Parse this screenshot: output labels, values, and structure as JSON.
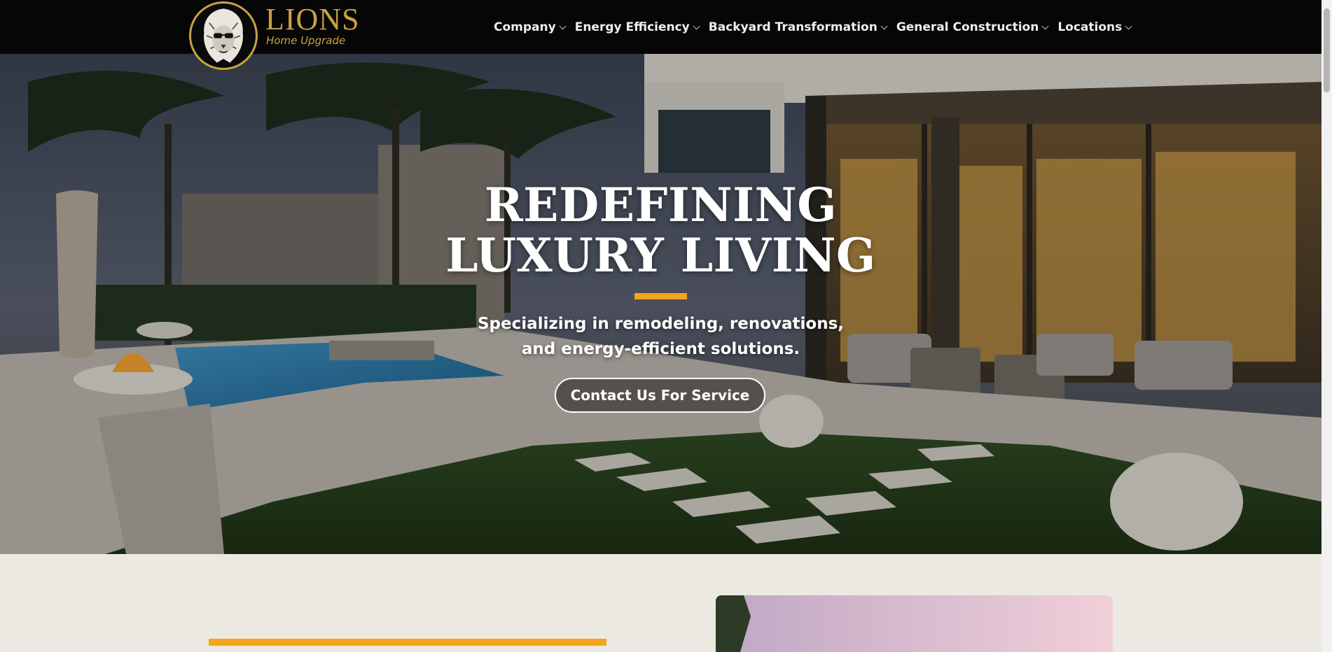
{
  "brand": {
    "title": "LIONS",
    "subtitle": "Home Upgrade",
    "logo_icon": "lion-head-icon",
    "gold": "#c9a341"
  },
  "nav": {
    "items": [
      {
        "label": "Company",
        "icon": "chevron-down-icon"
      },
      {
        "label": "Energy Efficiency",
        "icon": "chevron-down-icon"
      },
      {
        "label": "Backyard Transformation",
        "icon": "chevron-down-icon"
      },
      {
        "label": "General Construction",
        "icon": "chevron-down-icon"
      },
      {
        "label": "Locations",
        "icon": "chevron-down-icon"
      }
    ]
  },
  "hero": {
    "title_line1": "REDEFINING",
    "title_line2": "LUXURY LIVING",
    "subtitle_line1": "Specializing in remodeling, renovations,",
    "subtitle_line2": "and energy-efficient solutions.",
    "cta_label": "Contact Us For Service",
    "accent_color": "#f5a51c"
  },
  "colors": {
    "header_bg": "#060606",
    "page_bg": "#ece9e2",
    "accent": "#f5a51c"
  }
}
